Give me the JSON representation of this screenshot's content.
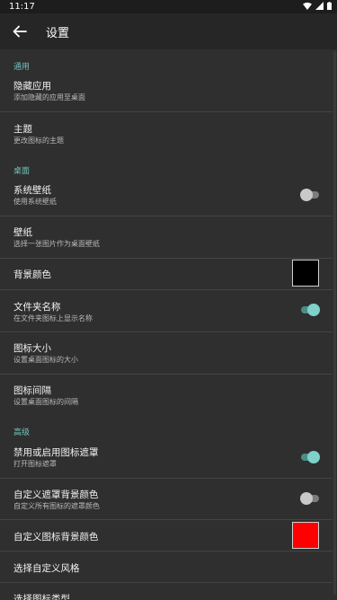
{
  "status_bar": {
    "time": "11:17",
    "icons": [
      "wifi-icon",
      "signal-icon",
      "battery-icon"
    ]
  },
  "app_bar": {
    "title": "设置",
    "back_icon": "arrow-left-icon"
  },
  "colors": {
    "accent": "#74c2ba",
    "background": "#2f2f2f",
    "toolbar": "#262626",
    "swatch_black": "#000000",
    "swatch_red": "#ff0000"
  },
  "sections": {
    "general": "通用",
    "desktop": "桌面",
    "advanced": "高级"
  },
  "items": {
    "hide_apps": {
      "title": "隐藏应用",
      "subtitle": "添加隐藏的应用至桌面"
    },
    "theme": {
      "title": "主题",
      "subtitle": "更改图标的主题"
    },
    "system_wallpaper": {
      "title": "系统壁纸",
      "subtitle": "使用系统壁纸",
      "enabled": false
    },
    "wallpaper": {
      "title": "壁纸",
      "subtitle": "选择一张图片作为桌面壁纸"
    },
    "background_color": {
      "title": "背景颜色",
      "color": "#000000"
    },
    "folder_name": {
      "title": "文件夹名称",
      "subtitle": "在文件夹图标上显示名称",
      "enabled": true
    },
    "icon_size": {
      "title": "图标大小",
      "subtitle": "设置桌面图标的大小"
    },
    "icon_spacing": {
      "title": "图标间隔",
      "subtitle": "设置桌面图标的间隔"
    },
    "icon_mask": {
      "title": "禁用或启用图标遮罩",
      "subtitle": "打开图标遮罩",
      "enabled": true
    },
    "mask_background": {
      "title": "自定义遮罩背景颜色",
      "subtitle": "自定义所有图标的遮罩颜色",
      "enabled": false
    },
    "icon_background": {
      "title": "自定义图标背景颜色",
      "color": "#ff0000"
    },
    "custom_style": {
      "title": "选择自定义风格"
    },
    "icon_type": {
      "title": "选择图标类型"
    }
  }
}
